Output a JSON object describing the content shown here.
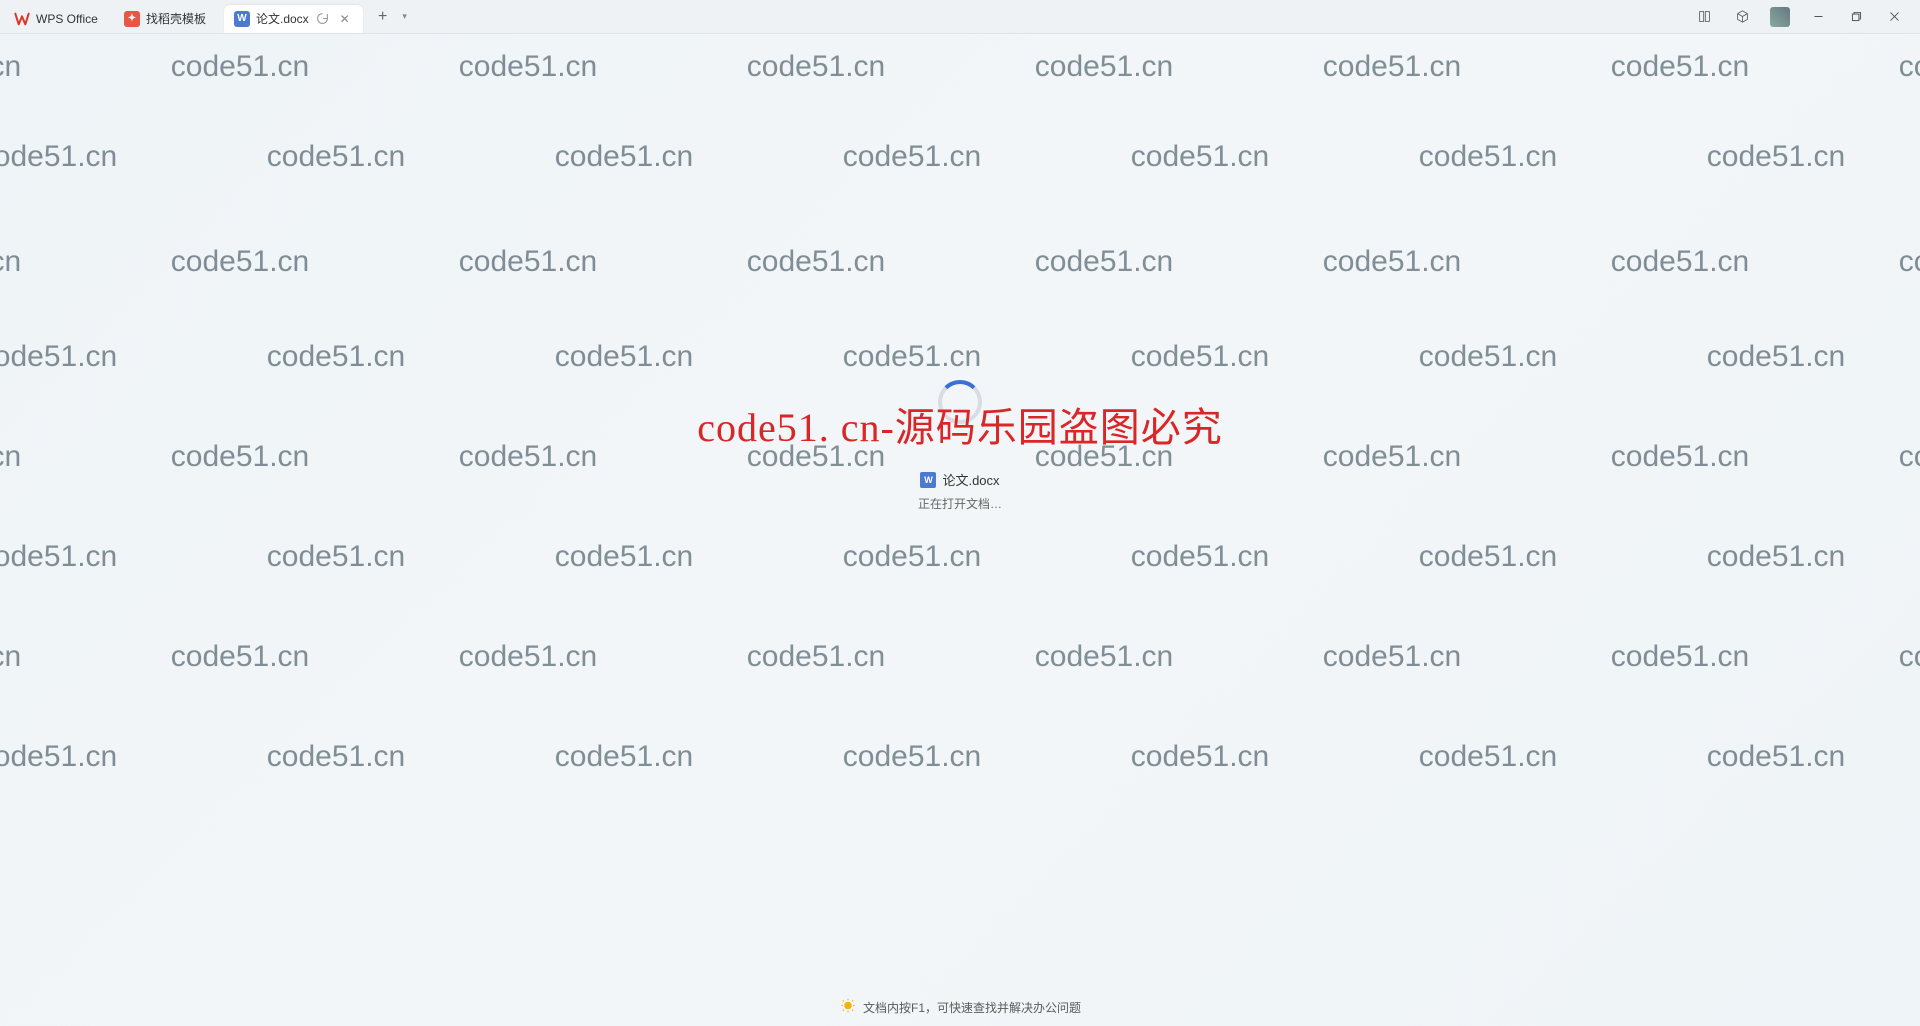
{
  "titlebar": {
    "tabs": [
      {
        "label": "WPS Office",
        "icon": "wps"
      },
      {
        "label": "找稻壳模板",
        "icon": "template"
      },
      {
        "label": "论文.docx",
        "icon": "word",
        "active": true
      }
    ],
    "new_tab_glyph": "+",
    "dropdown_glyph": "▾"
  },
  "loading": {
    "filename": "论文.docx",
    "status": "正在打开文档…"
  },
  "bottom_tip": "文档内按F1，可快速查找并解决办公问题",
  "watermark": {
    "text": "code51.cn",
    "big_red": "code51. cn-源码乐园盗图必究"
  }
}
